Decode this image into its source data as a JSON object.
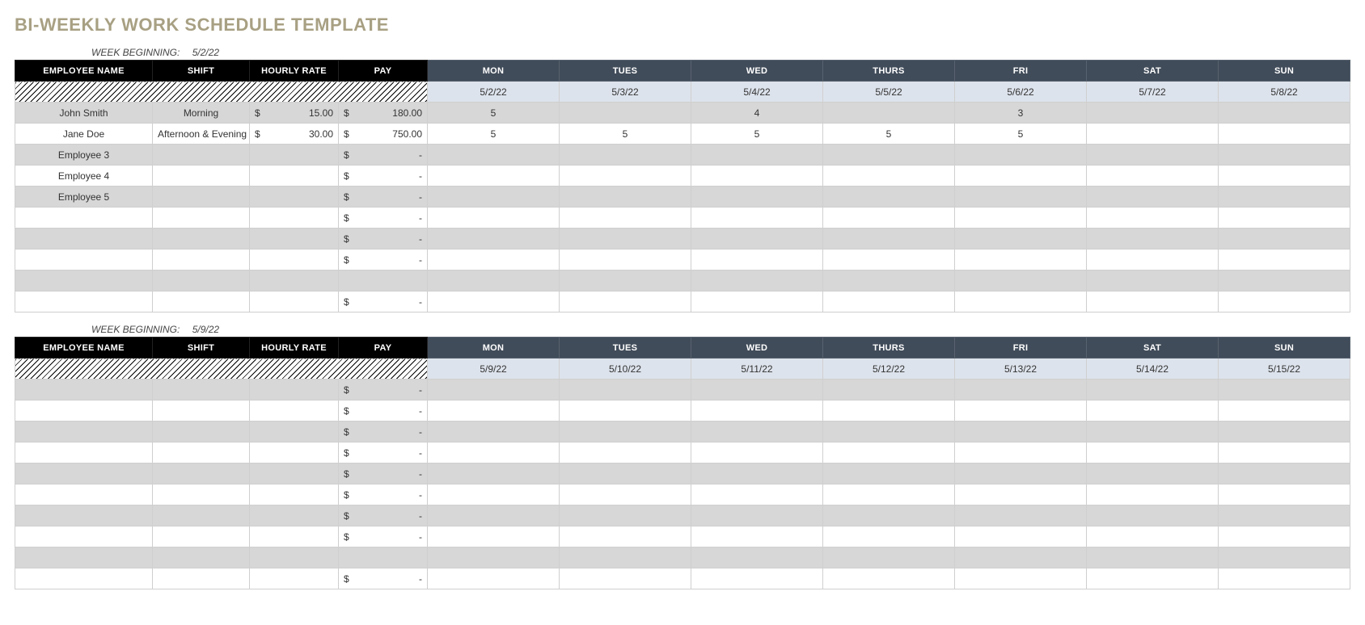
{
  "title": "BI-WEEKLY WORK SCHEDULE TEMPLATE",
  "week_begin_label": "WEEK BEGINNING:",
  "headers": {
    "name": "EMPLOYEE NAME",
    "shift": "SHIFT",
    "rate": "HOURLY RATE",
    "pay": "PAY",
    "days": [
      "MON",
      "TUES",
      "WED",
      "THURS",
      "FRI",
      "SAT",
      "SUN"
    ]
  },
  "currency": "$",
  "weeks": [
    {
      "beginning": "5/2/22",
      "dates": [
        "5/2/22",
        "5/3/22",
        "5/4/22",
        "5/5/22",
        "5/6/22",
        "5/7/22",
        "5/8/22"
      ],
      "rows": [
        {
          "name": "John Smith",
          "shift": "Morning",
          "rate": "15.00",
          "pay": "180.00",
          "days": [
            "5",
            "",
            "4",
            "",
            "3",
            "",
            ""
          ]
        },
        {
          "name": "Jane Doe",
          "shift": "Afternoon & Evening",
          "rate": "30.00",
          "pay": "750.00",
          "days": [
            "5",
            "5",
            "5",
            "5",
            "5",
            "",
            ""
          ]
        },
        {
          "name": "Employee 3",
          "shift": "",
          "rate": "",
          "pay": "-",
          "days": [
            "",
            "",
            "",
            "",
            "",
            "",
            ""
          ]
        },
        {
          "name": "Employee 4",
          "shift": "",
          "rate": "",
          "pay": "-",
          "days": [
            "",
            "",
            "",
            "",
            "",
            "",
            ""
          ]
        },
        {
          "name": "Employee 5",
          "shift": "",
          "rate": "",
          "pay": "-",
          "days": [
            "",
            "",
            "",
            "",
            "",
            "",
            ""
          ]
        },
        {
          "name": "",
          "shift": "",
          "rate": "",
          "pay": "-",
          "days": [
            "",
            "",
            "",
            "",
            "",
            "",
            ""
          ]
        },
        {
          "name": "",
          "shift": "",
          "rate": "",
          "pay": "-",
          "days": [
            "",
            "",
            "",
            "",
            "",
            "",
            ""
          ]
        },
        {
          "name": "",
          "shift": "",
          "rate": "",
          "pay": "-",
          "days": [
            "",
            "",
            "",
            "",
            "",
            "",
            ""
          ]
        },
        {
          "name": "",
          "shift": "",
          "rate": "",
          "pay": "",
          "days": [
            "",
            "",
            "",
            "",
            "",
            "",
            ""
          ]
        },
        {
          "name": "",
          "shift": "",
          "rate": "",
          "pay": "-",
          "days": [
            "",
            "",
            "",
            "",
            "",
            "",
            ""
          ]
        }
      ]
    },
    {
      "beginning": "5/9/22",
      "dates": [
        "5/9/22",
        "5/10/22",
        "5/11/22",
        "5/12/22",
        "5/13/22",
        "5/14/22",
        "5/15/22"
      ],
      "rows": [
        {
          "name": "",
          "shift": "",
          "rate": "",
          "pay": "-",
          "days": [
            "",
            "",
            "",
            "",
            "",
            "",
            ""
          ]
        },
        {
          "name": "",
          "shift": "",
          "rate": "",
          "pay": "-",
          "days": [
            "",
            "",
            "",
            "",
            "",
            "",
            ""
          ]
        },
        {
          "name": "",
          "shift": "",
          "rate": "",
          "pay": "-",
          "days": [
            "",
            "",
            "",
            "",
            "",
            "",
            ""
          ]
        },
        {
          "name": "",
          "shift": "",
          "rate": "",
          "pay": "-",
          "days": [
            "",
            "",
            "",
            "",
            "",
            "",
            ""
          ]
        },
        {
          "name": "",
          "shift": "",
          "rate": "",
          "pay": "-",
          "days": [
            "",
            "",
            "",
            "",
            "",
            "",
            ""
          ]
        },
        {
          "name": "",
          "shift": "",
          "rate": "",
          "pay": "-",
          "days": [
            "",
            "",
            "",
            "",
            "",
            "",
            ""
          ]
        },
        {
          "name": "",
          "shift": "",
          "rate": "",
          "pay": "-",
          "days": [
            "",
            "",
            "",
            "",
            "",
            "",
            ""
          ]
        },
        {
          "name": "",
          "shift": "",
          "rate": "",
          "pay": "-",
          "days": [
            "",
            "",
            "",
            "",
            "",
            "",
            ""
          ]
        },
        {
          "name": "",
          "shift": "",
          "rate": "",
          "pay": "",
          "days": [
            "",
            "",
            "",
            "",
            "",
            "",
            ""
          ]
        },
        {
          "name": "",
          "shift": "",
          "rate": "",
          "pay": "-",
          "days": [
            "",
            "",
            "",
            "",
            "",
            "",
            ""
          ]
        }
      ]
    }
  ]
}
